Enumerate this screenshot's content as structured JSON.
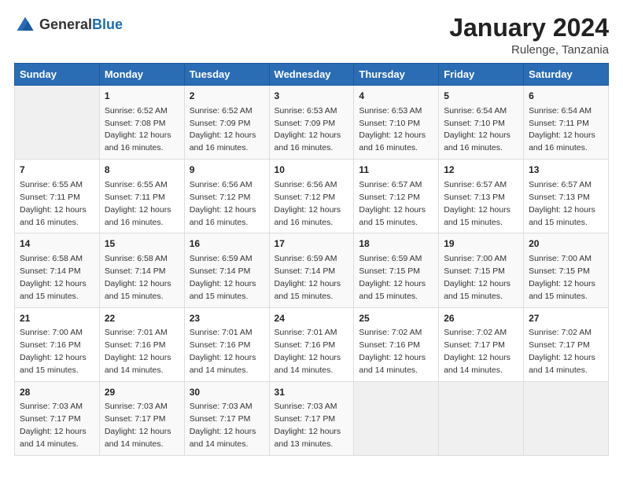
{
  "header": {
    "logo_general": "General",
    "logo_blue": "Blue",
    "title": "January 2024",
    "subtitle": "Rulenge, Tanzania"
  },
  "days_of_week": [
    "Sunday",
    "Monday",
    "Tuesday",
    "Wednesday",
    "Thursday",
    "Friday",
    "Saturday"
  ],
  "weeks": [
    [
      {
        "day": "",
        "info": ""
      },
      {
        "day": "1",
        "info": "Sunrise: 6:52 AM\nSunset: 7:08 PM\nDaylight: 12 hours and 16 minutes."
      },
      {
        "day": "2",
        "info": "Sunrise: 6:52 AM\nSunset: 7:09 PM\nDaylight: 12 hours and 16 minutes."
      },
      {
        "day": "3",
        "info": "Sunrise: 6:53 AM\nSunset: 7:09 PM\nDaylight: 12 hours and 16 minutes."
      },
      {
        "day": "4",
        "info": "Sunrise: 6:53 AM\nSunset: 7:10 PM\nDaylight: 12 hours and 16 minutes."
      },
      {
        "day": "5",
        "info": "Sunrise: 6:54 AM\nSunset: 7:10 PM\nDaylight: 12 hours and 16 minutes."
      },
      {
        "day": "6",
        "info": "Sunrise: 6:54 AM\nSunset: 7:11 PM\nDaylight: 12 hours and 16 minutes."
      }
    ],
    [
      {
        "day": "7",
        "info": "Sunrise: 6:55 AM\nSunset: 7:11 PM\nDaylight: 12 hours and 16 minutes."
      },
      {
        "day": "8",
        "info": "Sunrise: 6:55 AM\nSunset: 7:11 PM\nDaylight: 12 hours and 16 minutes."
      },
      {
        "day": "9",
        "info": "Sunrise: 6:56 AM\nSunset: 7:12 PM\nDaylight: 12 hours and 16 minutes."
      },
      {
        "day": "10",
        "info": "Sunrise: 6:56 AM\nSunset: 7:12 PM\nDaylight: 12 hours and 16 minutes."
      },
      {
        "day": "11",
        "info": "Sunrise: 6:57 AM\nSunset: 7:12 PM\nDaylight: 12 hours and 15 minutes."
      },
      {
        "day": "12",
        "info": "Sunrise: 6:57 AM\nSunset: 7:13 PM\nDaylight: 12 hours and 15 minutes."
      },
      {
        "day": "13",
        "info": "Sunrise: 6:57 AM\nSunset: 7:13 PM\nDaylight: 12 hours and 15 minutes."
      }
    ],
    [
      {
        "day": "14",
        "info": "Sunrise: 6:58 AM\nSunset: 7:14 PM\nDaylight: 12 hours and 15 minutes."
      },
      {
        "day": "15",
        "info": "Sunrise: 6:58 AM\nSunset: 7:14 PM\nDaylight: 12 hours and 15 minutes."
      },
      {
        "day": "16",
        "info": "Sunrise: 6:59 AM\nSunset: 7:14 PM\nDaylight: 12 hours and 15 minutes."
      },
      {
        "day": "17",
        "info": "Sunrise: 6:59 AM\nSunset: 7:14 PM\nDaylight: 12 hours and 15 minutes."
      },
      {
        "day": "18",
        "info": "Sunrise: 6:59 AM\nSunset: 7:15 PM\nDaylight: 12 hours and 15 minutes."
      },
      {
        "day": "19",
        "info": "Sunrise: 7:00 AM\nSunset: 7:15 PM\nDaylight: 12 hours and 15 minutes."
      },
      {
        "day": "20",
        "info": "Sunrise: 7:00 AM\nSunset: 7:15 PM\nDaylight: 12 hours and 15 minutes."
      }
    ],
    [
      {
        "day": "21",
        "info": "Sunrise: 7:00 AM\nSunset: 7:16 PM\nDaylight: 12 hours and 15 minutes."
      },
      {
        "day": "22",
        "info": "Sunrise: 7:01 AM\nSunset: 7:16 PM\nDaylight: 12 hours and 14 minutes."
      },
      {
        "day": "23",
        "info": "Sunrise: 7:01 AM\nSunset: 7:16 PM\nDaylight: 12 hours and 14 minutes."
      },
      {
        "day": "24",
        "info": "Sunrise: 7:01 AM\nSunset: 7:16 PM\nDaylight: 12 hours and 14 minutes."
      },
      {
        "day": "25",
        "info": "Sunrise: 7:02 AM\nSunset: 7:16 PM\nDaylight: 12 hours and 14 minutes."
      },
      {
        "day": "26",
        "info": "Sunrise: 7:02 AM\nSunset: 7:17 PM\nDaylight: 12 hours and 14 minutes."
      },
      {
        "day": "27",
        "info": "Sunrise: 7:02 AM\nSunset: 7:17 PM\nDaylight: 12 hours and 14 minutes."
      }
    ],
    [
      {
        "day": "28",
        "info": "Sunrise: 7:03 AM\nSunset: 7:17 PM\nDaylight: 12 hours and 14 minutes."
      },
      {
        "day": "29",
        "info": "Sunrise: 7:03 AM\nSunset: 7:17 PM\nDaylight: 12 hours and 14 minutes."
      },
      {
        "day": "30",
        "info": "Sunrise: 7:03 AM\nSunset: 7:17 PM\nDaylight: 12 hours and 14 minutes."
      },
      {
        "day": "31",
        "info": "Sunrise: 7:03 AM\nSunset: 7:17 PM\nDaylight: 12 hours and 13 minutes."
      },
      {
        "day": "",
        "info": ""
      },
      {
        "day": "",
        "info": ""
      },
      {
        "day": "",
        "info": ""
      }
    ]
  ]
}
